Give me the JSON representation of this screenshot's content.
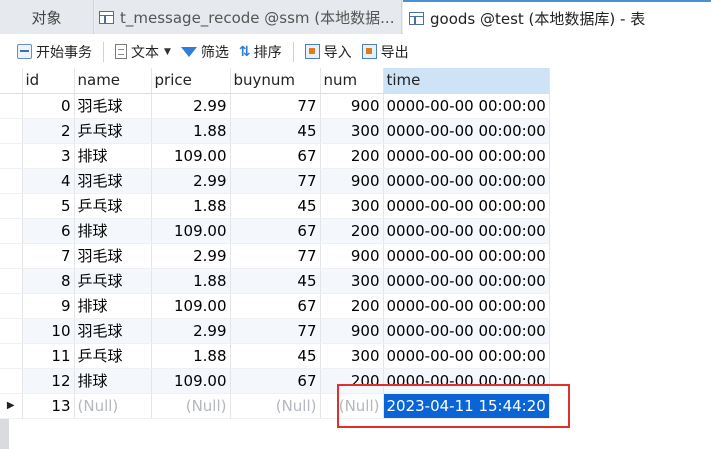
{
  "tabs": [
    {
      "label": "对象"
    },
    {
      "label": "t_message_recode @ssm (本地数据..."
    },
    {
      "label": "goods @test (本地数据库) - 表"
    }
  ],
  "toolbar": {
    "begin_transaction": "开始事务",
    "text": "文本",
    "filter": "筛选",
    "sort": "排序",
    "import": "导入",
    "export": "导出"
  },
  "table": {
    "columns": [
      "id",
      "name",
      "price",
      "buynum",
      "num",
      "time"
    ],
    "rows": [
      {
        "id": "0",
        "name": "羽毛球",
        "price": "2.99",
        "buynum": "77",
        "num": "900",
        "time": "0000-00-00 00:00:00"
      },
      {
        "id": "2",
        "name": "乒乓球",
        "price": "1.88",
        "buynum": "45",
        "num": "300",
        "time": "0000-00-00 00:00:00"
      },
      {
        "id": "3",
        "name": "排球",
        "price": "109.00",
        "buynum": "67",
        "num": "200",
        "time": "0000-00-00 00:00:00"
      },
      {
        "id": "4",
        "name": "羽毛球",
        "price": "2.99",
        "buynum": "77",
        "num": "900",
        "time": "0000-00-00 00:00:00"
      },
      {
        "id": "5",
        "name": "乒乓球",
        "price": "1.88",
        "buynum": "45",
        "num": "300",
        "time": "0000-00-00 00:00:00"
      },
      {
        "id": "6",
        "name": "排球",
        "price": "109.00",
        "buynum": "67",
        "num": "200",
        "time": "0000-00-00 00:00:00"
      },
      {
        "id": "7",
        "name": "羽毛球",
        "price": "2.99",
        "buynum": "77",
        "num": "900",
        "time": "0000-00-00 00:00:00"
      },
      {
        "id": "8",
        "name": "乒乓球",
        "price": "1.88",
        "buynum": "45",
        "num": "300",
        "time": "0000-00-00 00:00:00"
      },
      {
        "id": "9",
        "name": "排球",
        "price": "109.00",
        "buynum": "67",
        "num": "200",
        "time": "0000-00-00 00:00:00"
      },
      {
        "id": "10",
        "name": "羽毛球",
        "price": "2.99",
        "buynum": "77",
        "num": "900",
        "time": "0000-00-00 00:00:00"
      },
      {
        "id": "11",
        "name": "乒乓球",
        "price": "1.88",
        "buynum": "45",
        "num": "300",
        "time": "0000-00-00 00:00:00"
      },
      {
        "id": "12",
        "name": "排球",
        "price": "109.00",
        "buynum": "67",
        "num": "200",
        "time": "0000-00-00 00:00:00"
      }
    ],
    "new_row": {
      "id": "13",
      "name": "(Null)",
      "price": "(Null)",
      "buynum": "(Null)",
      "num": "(Null)",
      "time": "2023-04-11 15:44:20"
    },
    "current_row_marker": "▶"
  },
  "colors": {
    "selection": "#0a64d6",
    "highlight_box": "#e0302b",
    "alt_row": "#f4f8fd"
  }
}
